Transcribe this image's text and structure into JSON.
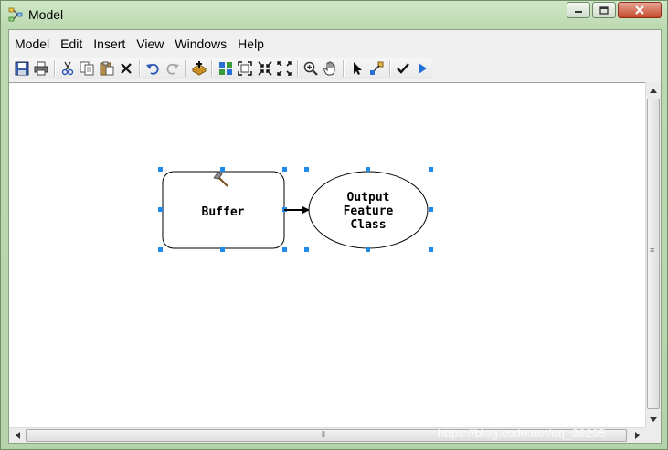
{
  "window": {
    "title": "Model",
    "controls": [
      "minimize",
      "maximize",
      "close"
    ]
  },
  "menu": {
    "items": [
      "Model",
      "Edit",
      "Insert",
      "View",
      "Windows",
      "Help"
    ]
  },
  "toolbar": {
    "buttons": [
      "save-icon",
      "print-icon",
      "cut-icon",
      "copy-icon",
      "paste-icon",
      "delete-icon",
      "undo-icon",
      "redo-icon",
      "add-data-icon",
      "auto-layout-icon",
      "full-extent-icon",
      "fixed-zoom-in-icon",
      "fixed-zoom-out-icon",
      "zoom-in-icon",
      "pan-icon",
      "select-icon",
      "connect-icon",
      "validate-icon",
      "run-icon"
    ]
  },
  "model": {
    "tool_node": {
      "label": "Buffer"
    },
    "output_node": {
      "label_lines": [
        "Output",
        "Feature",
        "Class"
      ]
    }
  },
  "colors": {
    "selection_handles": "#1e8be8",
    "window_chrome": "#bcd9b1",
    "close_button": "#c4482b"
  },
  "watermark": "https://blog.csdn.net/qq_36295"
}
